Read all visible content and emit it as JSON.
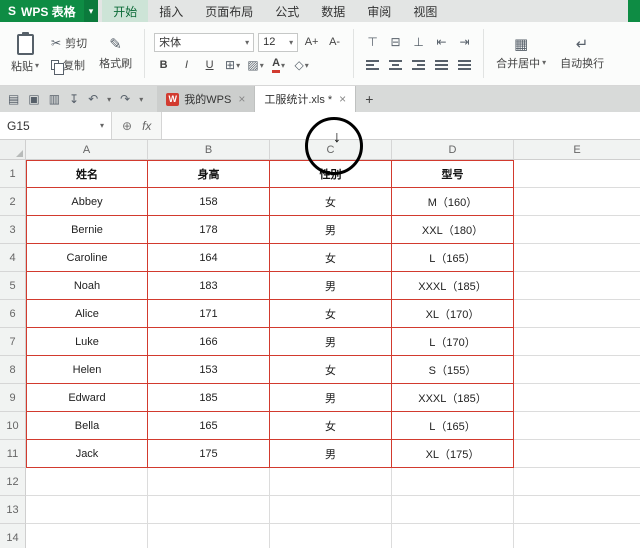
{
  "app": {
    "logo_letter": "S",
    "title": "WPS 表格",
    "menu_tabs": [
      "开始",
      "插入",
      "页面布局",
      "公式",
      "数据",
      "审阅",
      "视图"
    ],
    "active_menu_tab": "开始"
  },
  "ribbon": {
    "paste_label": "粘贴",
    "cut_label": "剪切",
    "copy_label": "复制",
    "format_painter_label": "格式刷",
    "font_name": "宋体",
    "font_size": "12",
    "size_up": "A+",
    "size_down": "A-",
    "bold": "B",
    "italic": "I",
    "underline": "U",
    "font_color_label": "A",
    "merge_center_label": "合并居中",
    "wrap_text_label": "自动换行"
  },
  "tabbar": {
    "doc_tabs": [
      {
        "label": "我的WPS",
        "badge": "W",
        "active": false
      },
      {
        "label": "工服统计.xls *",
        "active": true
      }
    ]
  },
  "formula_bar": {
    "name_box": "G15",
    "fx_label": "fx",
    "input_value": ""
  },
  "sheet": {
    "columns": [
      "A",
      "B",
      "C",
      "D",
      "E"
    ],
    "table_range": {
      "rows": 11,
      "cols": 4
    },
    "rows": [
      {
        "n": "1",
        "header": true,
        "cells": [
          "姓名",
          "身高",
          "性别",
          "型号",
          ""
        ]
      },
      {
        "n": "2",
        "cells": [
          "Abbey",
          "158",
          "女",
          "M（160）",
          ""
        ]
      },
      {
        "n": "3",
        "cells": [
          "Bernie",
          "178",
          "男",
          "XXL（180）",
          ""
        ]
      },
      {
        "n": "4",
        "cells": [
          "Caroline",
          "164",
          "女",
          "L（165）",
          ""
        ]
      },
      {
        "n": "5",
        "cells": [
          "Noah",
          "183",
          "男",
          "XXXL（185）",
          ""
        ]
      },
      {
        "n": "6",
        "cells": [
          "Alice",
          "171",
          "女",
          "XL（170）",
          ""
        ]
      },
      {
        "n": "7",
        "cells": [
          "Luke",
          "166",
          "男",
          "L（170）",
          ""
        ]
      },
      {
        "n": "8",
        "cells": [
          "Helen",
          "153",
          "女",
          "S（155）",
          ""
        ]
      },
      {
        "n": "9",
        "cells": [
          "Edward",
          "185",
          "男",
          "XXXL（185）",
          ""
        ]
      },
      {
        "n": "10",
        "cells": [
          "Bella",
          "165",
          "女",
          "L（165）",
          ""
        ]
      },
      {
        "n": "11",
        "cells": [
          "Jack",
          "175",
          "男",
          "XL（175）",
          ""
        ]
      },
      {
        "n": "12",
        "cells": [
          "",
          "",
          "",
          "",
          ""
        ]
      },
      {
        "n": "13",
        "cells": [
          "",
          "",
          "",
          "",
          ""
        ]
      },
      {
        "n": "14",
        "cells": [
          "",
          "",
          "",
          "",
          ""
        ]
      }
    ]
  },
  "icons": {
    "caret": "▾",
    "scissors": "✂",
    "format_painter": "✎",
    "borders": "⊞",
    "fill": "▨",
    "eraser": "◇",
    "align_top": "⊤",
    "align_middle": "⊟",
    "align_bottom": "⊥",
    "indent_dec": "⇤",
    "indent_inc": "⇥",
    "merge": "▦",
    "wrap": "↵",
    "file": "▤",
    "save": "▣",
    "print": "▥",
    "export": "↧",
    "undo": "↶",
    "redo": "↷",
    "search": "⊕",
    "close": "×",
    "plus": "+",
    "cursor_arrow": "↓"
  },
  "colors": {
    "wps_green": "#0e8c44",
    "table_border_red": "#d23a2e"
  }
}
